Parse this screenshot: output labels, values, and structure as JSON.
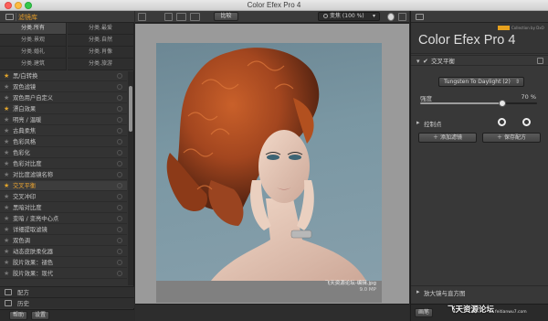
{
  "window": {
    "title": "Color Efex Pro 4"
  },
  "left_panel": {
    "header_label": "滤镜库",
    "categories": [
      {
        "label": "分类.所有",
        "selected": true
      },
      {
        "label": "分类.最爱",
        "selected": false
      },
      {
        "label": "分类.景观",
        "selected": false
      },
      {
        "label": "分类.自然",
        "selected": false
      },
      {
        "label": "分类.婚礼",
        "selected": false
      },
      {
        "label": "分类.肖像",
        "selected": false
      },
      {
        "label": "分类.建筑",
        "selected": false
      },
      {
        "label": "分类.旅游",
        "selected": false
      }
    ],
    "filters": [
      {
        "label": "黑/白转换",
        "favorite": true,
        "highlighted": false
      },
      {
        "label": "双色滤镜",
        "favorite": false,
        "highlighted": false
      },
      {
        "label": "双色用户自定义",
        "favorite": false,
        "highlighted": false
      },
      {
        "label": "漂白效果",
        "favorite": true,
        "highlighted": false
      },
      {
        "label": "明亮 / 温暖",
        "favorite": false,
        "highlighted": false
      },
      {
        "label": "古典柔焦",
        "favorite": false,
        "highlighted": false
      },
      {
        "label": "色彩风格",
        "favorite": false,
        "highlighted": false
      },
      {
        "label": "色彩化",
        "favorite": false,
        "highlighted": false
      },
      {
        "label": "色彩对比度",
        "favorite": false,
        "highlighted": false
      },
      {
        "label": "对比度滤镜名称",
        "favorite": false,
        "highlighted": false
      },
      {
        "label": "交叉平衡",
        "favorite": true,
        "highlighted": true
      },
      {
        "label": "交叉冲印",
        "favorite": false,
        "highlighted": false
      },
      {
        "label": "黑暗对比度",
        "favorite": false,
        "highlighted": false
      },
      {
        "label": "变暗 / 变亮中心点",
        "favorite": false,
        "highlighted": false
      },
      {
        "label": "详细提取滤镜",
        "favorite": false,
        "highlighted": false
      },
      {
        "label": "双色调",
        "favorite": false,
        "highlighted": false
      },
      {
        "label": "动态皮肤柔化器",
        "favorite": false,
        "highlighted": false
      },
      {
        "label": "胶片效果：褪色",
        "favorite": false,
        "highlighted": false
      },
      {
        "label": "胶片效果：现代",
        "favorite": false,
        "highlighted": false
      }
    ],
    "recipes_label": "配方",
    "history_label": "历史",
    "help_button": "帮助",
    "settings_button": "设置"
  },
  "toolbar": {
    "compare_label": "比较",
    "zoom_label": "变焦 (100 %)",
    "zoom_caret": "▾"
  },
  "canvas": {
    "file_name": "飞天资源论坛-编辑.jpg",
    "megapixels": "9.0 MP"
  },
  "right_panel": {
    "brand": "Color Efex Pro 4",
    "badge_text": "nik",
    "badge_tag": "Collection by DxO",
    "filter_section": "交叉平衡",
    "preset_value": "Tungsten To Daylight (2)",
    "strength_label": "强度",
    "strength_value": "70 %",
    "strength_fraction": 0.7,
    "control_points_label": "控制点",
    "add_filter_button": "添加滤镜",
    "save_recipe_button": "保存配方",
    "loupe_label": "放大镜与直方图",
    "bottom_label": "画笔"
  },
  "watermark": {
    "main": "飞天资源论坛",
    "sub": "feitianwu7.com"
  },
  "colors": {
    "accent": "#e8a02c",
    "panel": "#333333",
    "canvas": "#9a9a9a"
  }
}
